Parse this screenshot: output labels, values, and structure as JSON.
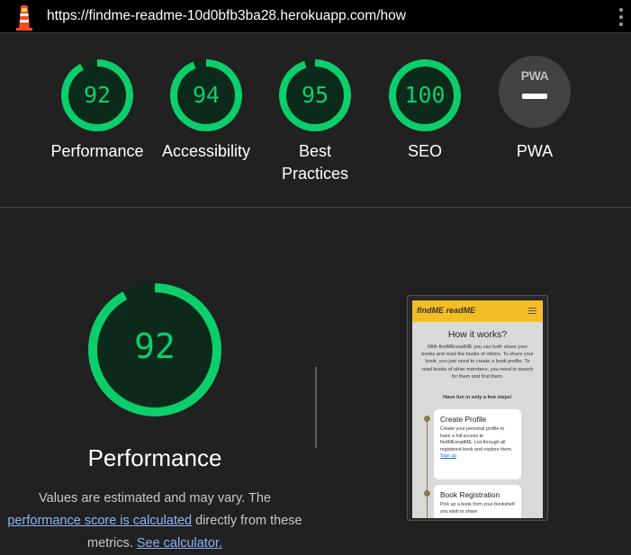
{
  "topbar": {
    "url": "https://findme-readme-10d0bfb3ba28.herokuapp.com/how",
    "logo_icon": "lighthouse-icon",
    "menu_icon": "kebab-menu-icon"
  },
  "scores": [
    {
      "label": "Performance",
      "value": "92",
      "fraction": 0.92
    },
    {
      "label": "Accessibility",
      "value": "94",
      "fraction": 0.94
    },
    {
      "label": "Best Practices",
      "value": "95",
      "fraction": 0.95
    },
    {
      "label": "SEO",
      "value": "100",
      "fraction": 1.0
    }
  ],
  "pwa": {
    "badge": "PWA",
    "label": "PWA"
  },
  "colors": {
    "pass": "#0cce6b",
    "pass_bg": "#0b2a1a",
    "link": "#8ab4f8",
    "background": "#212121"
  },
  "detail": {
    "score": "92",
    "fraction": 0.92,
    "title": "Performance",
    "desc_prefix": "Values are estimated and may vary. The",
    "link_score": "performance score is calculated",
    "desc_middle": "directly from these metrics.",
    "link_calculator": "See calculator."
  },
  "screenshot": {
    "logo": "findME readME",
    "heading": "How it works?",
    "intro": "With findMEreadME you can both share your books and read the books of others. To share your book, you just need to create a book profile. To read books of other members, you need to search for them and find them.",
    "tagline": "Have fun in only a few steps!",
    "cards": [
      {
        "title": "Create Profile",
        "text": "Create your personal profile to have a full access to findMEreadME. List through all registered book and explore them.",
        "link": "Sign up"
      },
      {
        "title": "Book Registration",
        "text": "Pick up a book from your bookshelf you wish to share",
        "link": ""
      }
    ]
  }
}
